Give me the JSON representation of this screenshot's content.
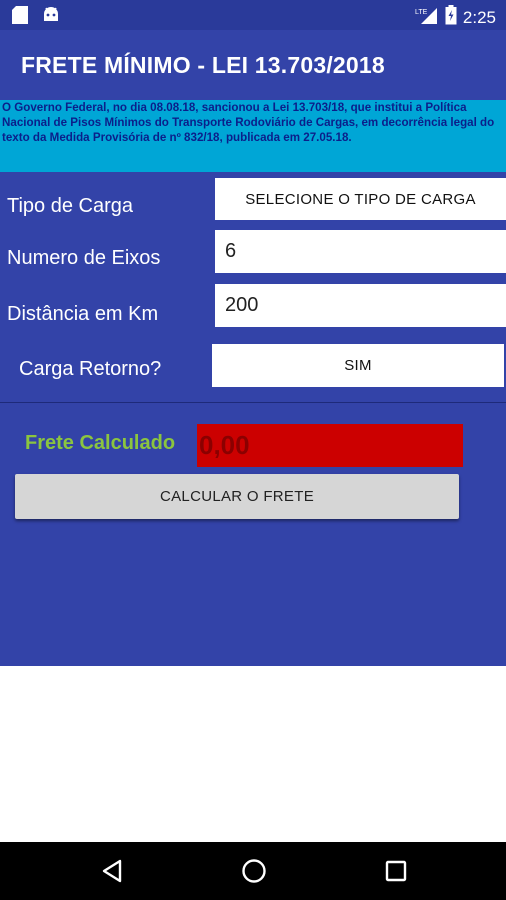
{
  "status_bar": {
    "time": "2:25",
    "network": "LTE"
  },
  "app_bar": {
    "title": "FRETE MÍNIMO - LEI 13.703/2018"
  },
  "info": {
    "text": "O Governo Federal, no dia 08.08.18, sancionou a Lei 13.703/18, que institui a Política Nacional de Pisos Mínimos do Transporte Rodoviário de Cargas, em decorrência legal do texto da Medida Provisória de nº 832/18, publicada em 27.05.18."
  },
  "form": {
    "tipo_carga_label": "Tipo de Carga",
    "tipo_carga_value": "SELECIONE O TIPO DE CARGA",
    "eixos_label": "Numero de Eixos",
    "eixos_value": "6",
    "distancia_label": "Distância em Km",
    "distancia_value": "200",
    "retorno_label": "Carga Retorno?",
    "retorno_value": "SIM"
  },
  "result": {
    "label": "Frete Calculado",
    "value": "0,00"
  },
  "actions": {
    "calculate_label": "CALCULAR O FRETE"
  },
  "colors": {
    "primary": "#3343a8",
    "primary_dark": "#2a3a9a",
    "banner": "#00a6d6",
    "result_label": "#8bc53f",
    "result_bg": "#cc0000"
  },
  "icons": {
    "status_left": [
      "sd-card-icon",
      "android-icon"
    ],
    "status_right": [
      "signal-icon",
      "battery-icon"
    ],
    "nav": [
      "back-icon",
      "home-icon",
      "recents-icon"
    ]
  }
}
